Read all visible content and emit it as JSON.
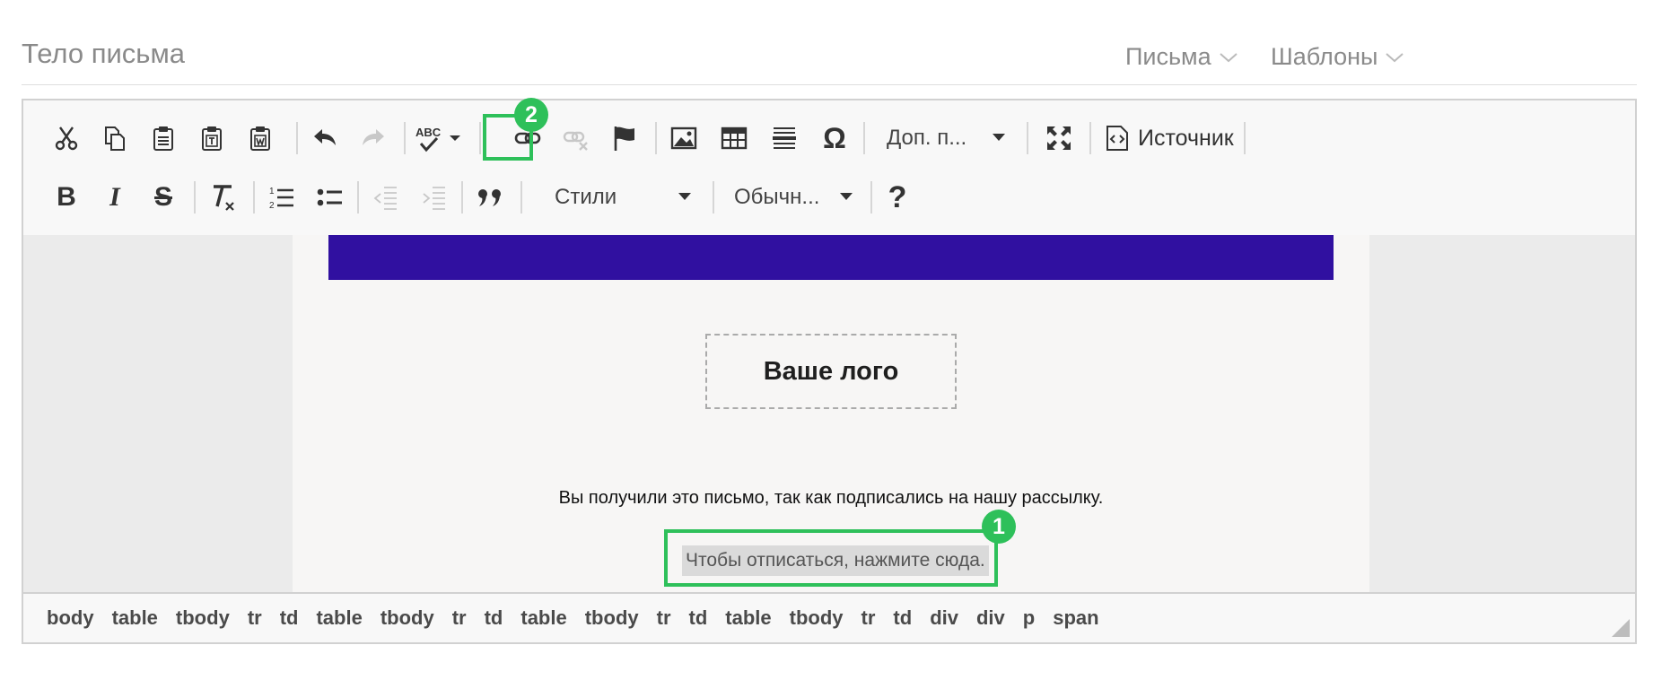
{
  "header": {
    "field_label": "Тело письма",
    "menus": [
      {
        "label": "Письма",
        "icon": "chevron-down-icon"
      },
      {
        "label": "Шаблоны",
        "icon": "chevron-down-icon"
      }
    ]
  },
  "toolbar": {
    "row1": [
      {
        "name": "cut-button",
        "icon": "scissors-icon"
      },
      {
        "name": "copy-button",
        "icon": "copy-icon"
      },
      {
        "name": "paste-button",
        "icon": "paste-icon"
      },
      {
        "name": "paste-text-button",
        "icon": "paste-text-icon"
      },
      {
        "name": "paste-word-button",
        "icon": "paste-word-icon"
      },
      {
        "name": "undo-button",
        "icon": "undo-icon"
      },
      {
        "name": "redo-button",
        "icon": "redo-icon"
      },
      {
        "name": "spellcheck-button",
        "icon": "spellcheck-icon",
        "label": "ABC"
      },
      {
        "name": "link-button",
        "icon": "link-icon"
      },
      {
        "name": "unlink-button",
        "icon": "unlink-icon"
      },
      {
        "name": "anchor-button",
        "icon": "flag-icon"
      },
      {
        "name": "image-button",
        "icon": "image-icon"
      },
      {
        "name": "table-button",
        "icon": "table-icon"
      },
      {
        "name": "horizontal-rule-button",
        "icon": "horizontal-rule-icon"
      },
      {
        "name": "special-char-button",
        "icon": "omega-icon",
        "label": "Ω"
      }
    ],
    "extra_combo": "Доп. п...",
    "maximize_icon": "maximize-icon",
    "source_label": "Источник",
    "row2": [
      {
        "name": "bold-button",
        "label": "B"
      },
      {
        "name": "italic-button",
        "label": "I"
      },
      {
        "name": "strike-button",
        "label": "S"
      },
      {
        "name": "remove-format-button",
        "label": "T"
      },
      {
        "name": "numbered-list-button",
        "icon": "numbered-list-icon"
      },
      {
        "name": "bulleted-list-button",
        "icon": "bulleted-list-icon"
      },
      {
        "name": "outdent-button",
        "icon": "outdent-icon"
      },
      {
        "name": "indent-button",
        "icon": "indent-icon"
      },
      {
        "name": "blockquote-button",
        "icon": "quote-icon"
      }
    ],
    "styles_combo": "Стили",
    "format_combo": "Обычн...",
    "help_label": "?"
  },
  "annotations": {
    "badge1": "1",
    "badge2": "2",
    "highlight_color": "#2ec05a"
  },
  "email": {
    "banner_color": "#3010a0",
    "logo_text": "Ваше лого",
    "notice_text": "Вы получили это письмо, так как подписались на нашу рассылку.",
    "unsubscribe_text": "Чтобы отписаться, нажмите сюда."
  },
  "path": [
    "body",
    "table",
    "tbody",
    "tr",
    "td",
    "table",
    "tbody",
    "tr",
    "td",
    "table",
    "tbody",
    "tr",
    "td",
    "table",
    "tbody",
    "tr",
    "td",
    "div",
    "div",
    "p",
    "span"
  ]
}
